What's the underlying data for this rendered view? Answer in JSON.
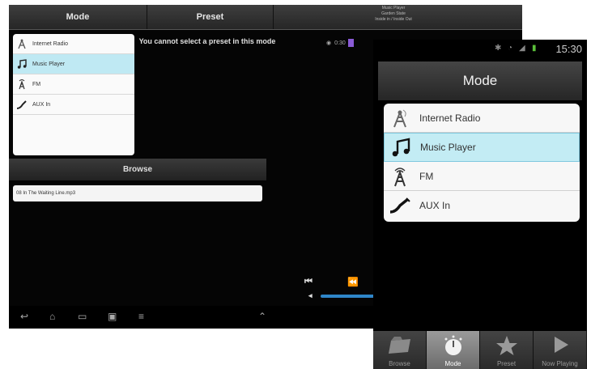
{
  "tablet": {
    "tabs": {
      "mode": "Mode",
      "preset": "Preset"
    },
    "now_playing": {
      "line1": "Music Player",
      "line2": "Garden State",
      "line3": "Inside in / Inside Out"
    },
    "mode_list": [
      {
        "label": "Internet Radio",
        "icon": "radio-tower-icon",
        "selected": false
      },
      {
        "label": "Music Player",
        "icon": "music-note-icon",
        "selected": true
      },
      {
        "label": "FM",
        "icon": "fm-antenna-icon",
        "selected": false
      },
      {
        "label": "AUX In",
        "icon": "aux-cable-icon",
        "selected": false
      }
    ],
    "preset_message": "You cannot select a preset in this mode",
    "browse": {
      "header": "Browse",
      "file": "08 In The Waiting Line.mp3"
    },
    "volume": {
      "time": "0:30"
    },
    "colors": {
      "accent": "#2f86c9",
      "selected_row": "#bfe9f3"
    }
  },
  "phone": {
    "status": {
      "time": "15:30"
    },
    "title": "Mode",
    "mode_list": [
      {
        "label": "Internet Radio",
        "icon": "radio-tower-icon",
        "selected": false
      },
      {
        "label": "Music Player",
        "icon": "music-note-icon",
        "selected": true
      },
      {
        "label": "FM",
        "icon": "fm-antenna-icon",
        "selected": false
      },
      {
        "label": "AUX In",
        "icon": "aux-cable-icon",
        "selected": false
      }
    ],
    "bottom_tabs": [
      {
        "label": "Browse",
        "icon": "folder-icon",
        "active": false
      },
      {
        "label": "Mode",
        "icon": "mode-dial-icon",
        "active": true
      },
      {
        "label": "Preset",
        "icon": "star-icon",
        "active": false
      },
      {
        "label": "Now Playing",
        "icon": "play-icon",
        "active": false
      }
    ],
    "colors": {
      "selected_row": "#c3ecf4"
    }
  }
}
